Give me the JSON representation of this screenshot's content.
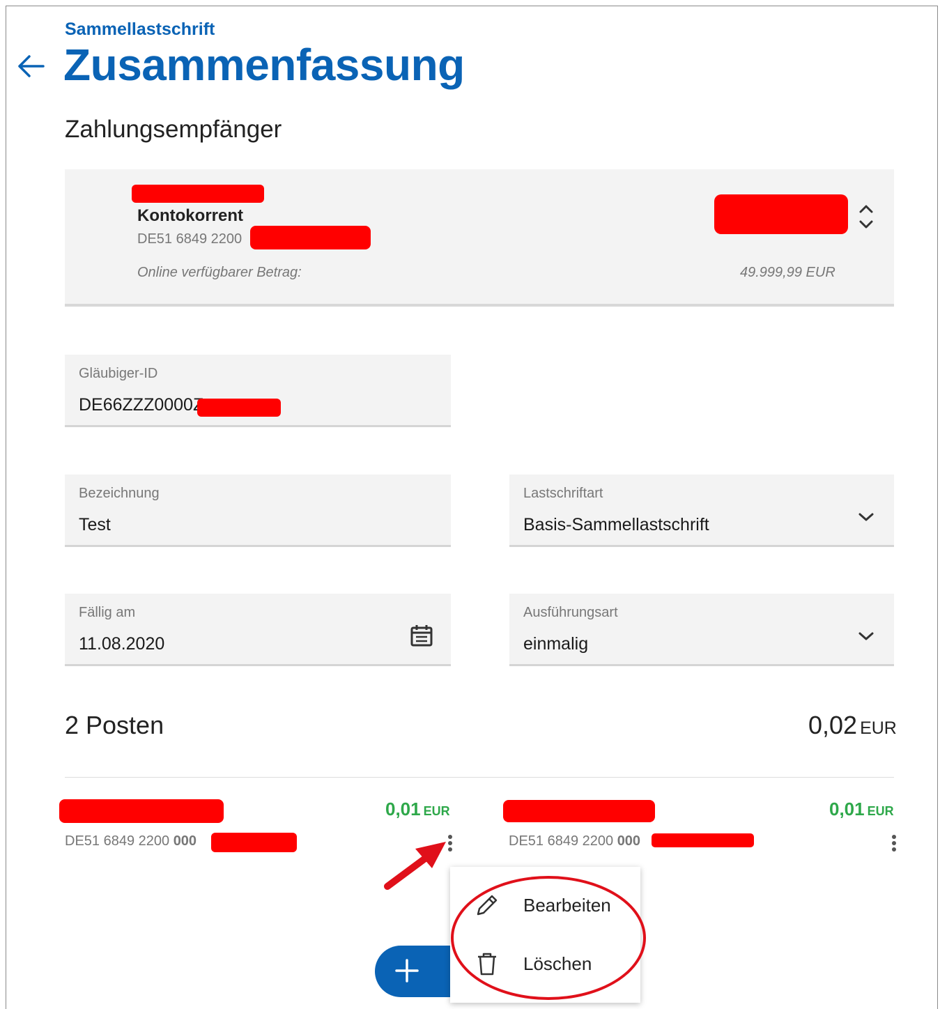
{
  "header": {
    "subtitle": "Sammellastschrift",
    "title": "Zusammenfassung",
    "back_icon": "arrow-left-icon"
  },
  "payee": {
    "section_title": "Zahlungsempfänger",
    "account_type": "Kontokorrent",
    "iban_prefix": "DE51 6849 2200",
    "available_label": "Online verfügbarer Betrag:",
    "available_value": "49.999,99 EUR",
    "sort_icon": "unfold-icon"
  },
  "fields": {
    "creditor_id": {
      "label": "Gläubiger-ID",
      "value": "DE66ZZZ0000Z"
    },
    "description": {
      "label": "Bezeichnung",
      "value": "Test"
    },
    "debit_type": {
      "label": "Lastschriftart",
      "value": "Basis-Sammellastschrift"
    },
    "due_date": {
      "label": "Fällig am",
      "value": "11.08.2020",
      "icon": "calendar-icon"
    },
    "execution_type": {
      "label": "Ausführungsart",
      "value": "einmalig"
    }
  },
  "summary": {
    "count_label": "2 Posten",
    "total_value": "0,02",
    "total_currency": "EUR"
  },
  "items": [
    {
      "amount": "0,01",
      "currency": "EUR",
      "iban_prefix": "DE51 6849 2200 ",
      "iban_bold": "000"
    },
    {
      "amount": "0,01",
      "currency": "EUR",
      "iban_prefix": "DE51 6849 2200 ",
      "iban_bold": "000"
    }
  ],
  "context_menu": {
    "items": [
      {
        "label": "Bearbeiten",
        "icon": "pencil-icon"
      },
      {
        "label": "Löschen",
        "icon": "trash-icon"
      }
    ]
  },
  "colors": {
    "brand_blue": "#0a63b5",
    "positive_green": "#2ea84a",
    "redaction": "#ff0000",
    "annotation_red": "#e0101a"
  }
}
